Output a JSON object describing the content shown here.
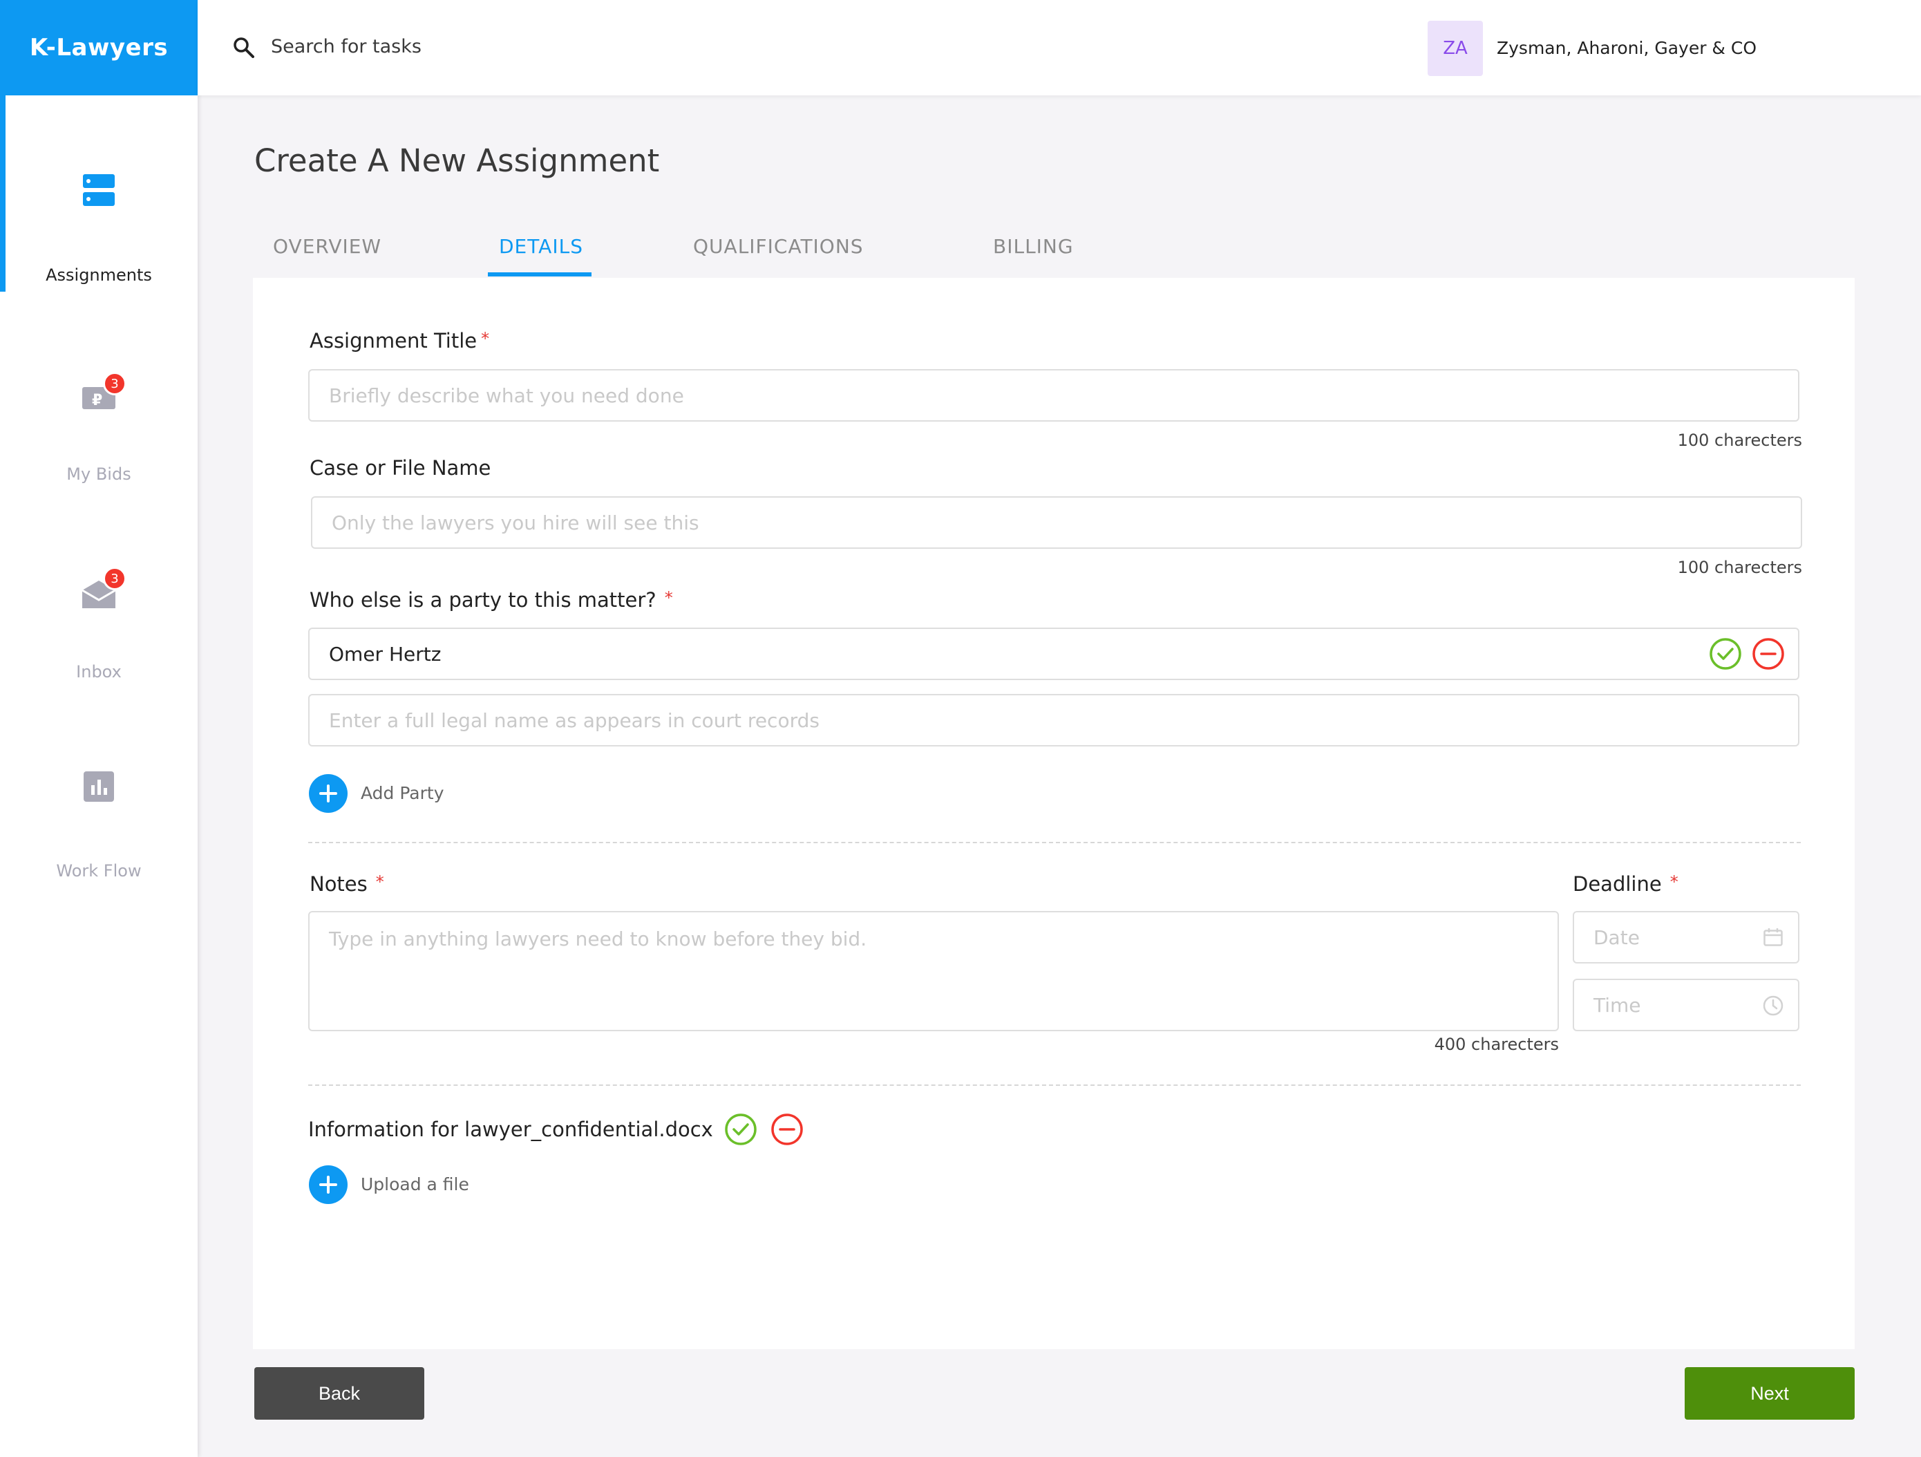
{
  "app": {
    "name": "K-Lawyers"
  },
  "sidebar": {
    "items": [
      {
        "label": "Assignments",
        "icon": "assignments-icon",
        "active": true
      },
      {
        "label": "My Bids",
        "icon": "bids-icon",
        "badge": "3"
      },
      {
        "label": "Inbox",
        "icon": "inbox-icon",
        "badge": "3"
      },
      {
        "label": "Work Flow",
        "icon": "chart-icon"
      }
    ]
  },
  "header": {
    "search_placeholder": "Search for tasks",
    "avatar_initials": "ZA",
    "firm_name": "Zysman, Aharoni, Gayer & CO"
  },
  "page": {
    "title": "Create A New Assignment"
  },
  "tabs": [
    {
      "label": "OVERVIEW"
    },
    {
      "label": "DETAILS",
      "active": true
    },
    {
      "label": "QUALIFICATIONS"
    },
    {
      "label": "BILLING"
    }
  ],
  "form": {
    "title_label": "Assignment Title",
    "title_placeholder": "Briefly describe what you need done",
    "title_counter": "100 charecters",
    "case_label": "Case or File Name",
    "case_placeholder": "Only the lawyers you hire will see this",
    "case_counter": "100 charecters",
    "party_label": "Who else is a party to this matter?",
    "party_value": "Omer Hertz",
    "party_placeholder": "Enter a full legal name as appears in court records",
    "add_party_label": "Add Party",
    "notes_label": "Notes",
    "notes_placeholder": "Type in anything lawyers need to know before they bid.",
    "notes_counter": "400 charecters",
    "deadline_label": "Deadline",
    "date_placeholder": "Date",
    "time_placeholder": "Time",
    "file_label": "Information for lawyer_confidential.docx",
    "upload_label": "Upload a file",
    "required_mark": "*"
  },
  "footer": {
    "back_label": "Back",
    "next_label": "Next"
  },
  "colors": {
    "accent": "#0d99f2",
    "next": "#4e8f0b",
    "back": "#4a4a4a",
    "confirm": "#6bbf2a",
    "remove": "#f2352b"
  }
}
